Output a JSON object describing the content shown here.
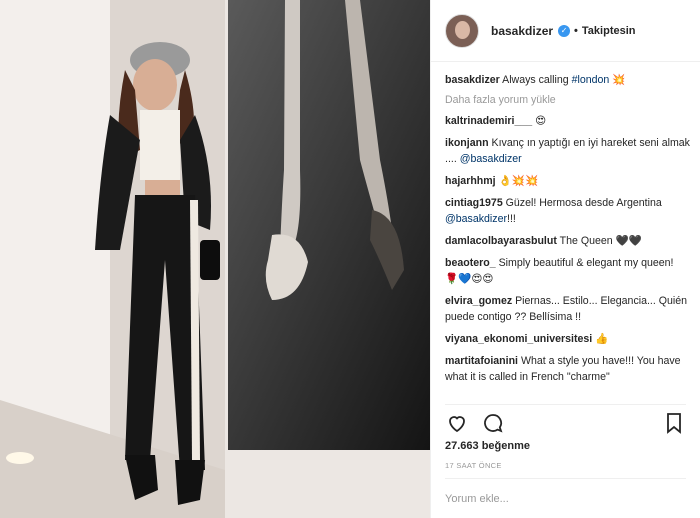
{
  "post": {
    "author": "basakdizer",
    "follow_status": "Takiptesin",
    "separator": "•",
    "caption_text": "Always calling ",
    "caption_tag": "#london",
    "caption_emoji": "💥",
    "load_more": "Daha fazla yorum yükle",
    "likes": "27.663 beğenme",
    "timestamp": "17 SAAT ÖNCE",
    "add_comment_placeholder": "Yorum ekle..."
  },
  "comments": [
    {
      "user": "kaltrinademiri___",
      "text": "",
      "mention": "",
      "emoji": "😍"
    },
    {
      "user": "ikonjann",
      "text": "Kıvanç ın yaptığı en iyi hareket seni almak .... ",
      "mention": "@basakdizer",
      "emoji": ""
    },
    {
      "user": "hajarhhmj",
      "text": "",
      "mention": "",
      "emoji": "👌💥💥"
    },
    {
      "user": "cintiag1975",
      "text": "Güzel! Hermosa desde Argentina ",
      "mention": "@basakdizer",
      "emoji": "!!!"
    },
    {
      "user": "damlacolbayarasbulut",
      "text": "The Queen ",
      "mention": "",
      "emoji": "🖤🖤"
    },
    {
      "user": "beaotero_",
      "text": "Simply beautiful & elegant my queen! ",
      "mention": "",
      "emoji": "🌹💙😍😍"
    },
    {
      "user": "elvira_gomez",
      "text": "Piernas... Estilo... Elegancia... Quién puede contigo ?? Bellísima !!",
      "mention": "",
      "emoji": ""
    },
    {
      "user": "viyana_ekonomi_universitesi",
      "text": "",
      "mention": "",
      "emoji": "👍"
    },
    {
      "user": "martitafoianini",
      "text": "What a style you have!!! You have what it is called in French \"charme\"",
      "mention": "",
      "emoji": ""
    }
  ],
  "icons": {
    "verified": "verified-badge-icon",
    "like": "heart-icon",
    "comment": "comment-bubble-icon",
    "save": "bookmark-icon"
  },
  "colors": {
    "link": "#003569",
    "verified": "#3897f0",
    "muted": "#999999",
    "text": "#262626"
  }
}
